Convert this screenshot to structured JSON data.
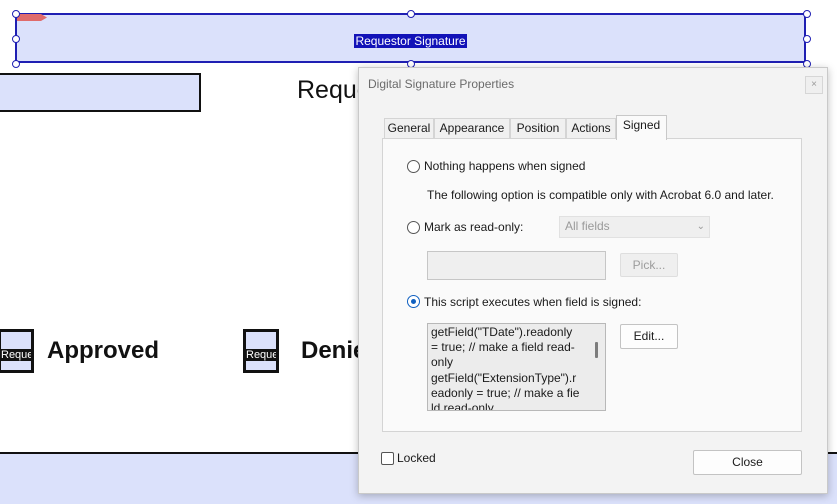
{
  "form": {
    "signature_field_label": "Requestor Signature",
    "heading_partial": "Reque",
    "checkbox_fields": [
      {
        "text": "Reques",
        "label": "Approved"
      },
      {
        "text": "Reques",
        "label": "Denie"
      }
    ]
  },
  "dialog": {
    "title": "Digital Signature Properties",
    "close_symbol": "×",
    "tabs": [
      "General",
      "Appearance",
      "Position",
      "Actions",
      "Signed"
    ],
    "active_tab": "Signed",
    "options": {
      "nothing_label": "Nothing happens when signed",
      "compat_note": "The following option is compatible only with Acrobat 6.0 and later.",
      "readonly_label": "Mark as read-only:",
      "readonly_select_value": "All fields",
      "pick_button": "Pick...",
      "script_label": "This script executes when field is signed:",
      "edit_button": "Edit...",
      "script_text": "getField(\"TDate\").readonly = true; // make a field read-only\ngetField(\"ExtensionType\").readonly = true; // make a field read-only",
      "selected": "script"
    },
    "locked_label": "Locked",
    "locked_checked": false,
    "close_button": "Close"
  },
  "colors": {
    "field_fill": "#dbe1fb",
    "field_border": "#1f1fb3",
    "accent": "#1060c0"
  }
}
